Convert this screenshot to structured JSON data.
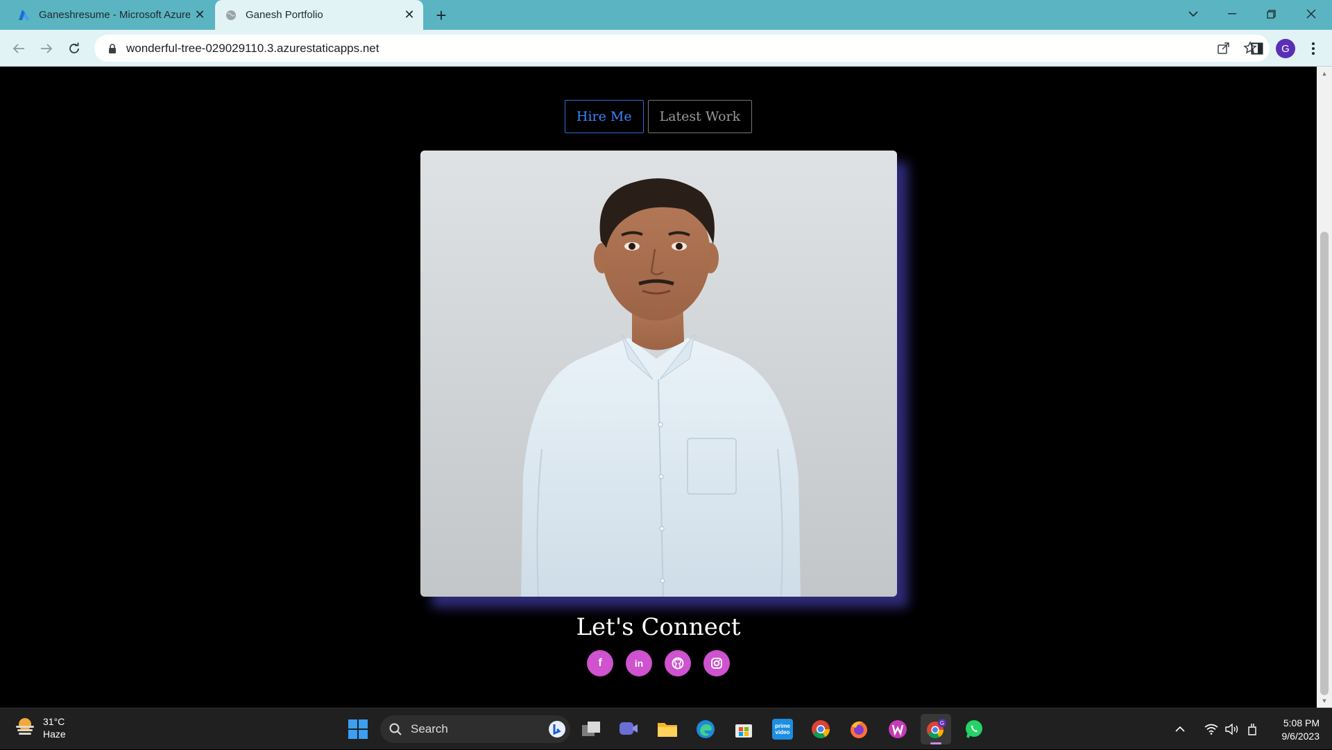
{
  "browser": {
    "tabs": [
      {
        "title": "Ganeshresume - Microsoft Azure",
        "icon": "azure-icon",
        "active": false
      },
      {
        "title": "Ganesh Portfolio",
        "icon": "globe-icon",
        "active": true
      }
    ],
    "url": "wonderful-tree-029029110.3.azurestaticapps.net",
    "profile_initial": "G",
    "accent": "#5bb4c1"
  },
  "page": {
    "buttons": {
      "hire": "Hire Me",
      "work": "Latest Work"
    },
    "photo_alt": "Portrait photo",
    "connect_heading": "Let's Connect",
    "social": [
      {
        "name": "facebook-icon",
        "glyph": "f"
      },
      {
        "name": "linkedin-icon",
        "glyph": "in"
      },
      {
        "name": "github-icon",
        "glyph": ""
      },
      {
        "name": "instagram-icon",
        "glyph": ""
      }
    ],
    "colors": {
      "hire_border": "#2f6fd8",
      "social_bg": "#cf52cf",
      "photo_shadow": "#2f2a78"
    }
  },
  "taskbar": {
    "weather_temp": "31°C",
    "weather_cond": "Haze",
    "search_label": "Search",
    "time": "5:08 PM",
    "date": "9/6/2023"
  }
}
